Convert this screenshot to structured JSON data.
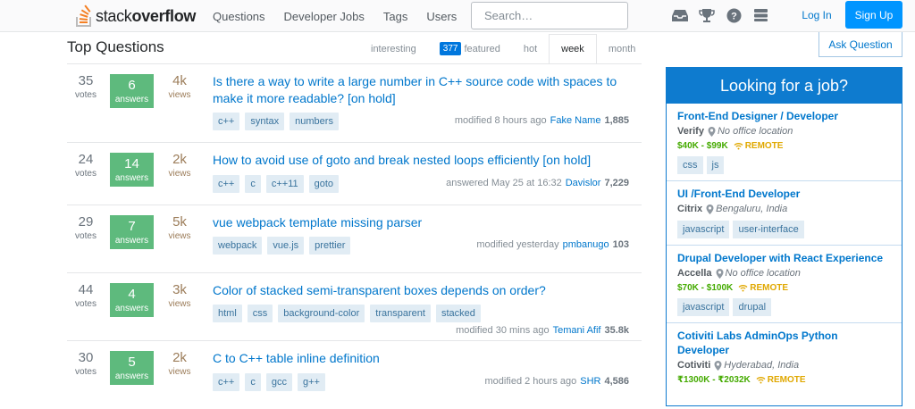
{
  "header": {
    "logo_text_light": "stack",
    "logo_text_bold": "overflow",
    "nav": [
      "Questions",
      "Developer Jobs",
      "Tags",
      "Users"
    ],
    "search_placeholder": "Search…",
    "icons": [
      "inbox-icon",
      "trophy-icon",
      "help-icon",
      "review-queue-icon"
    ],
    "login_label": "Log In",
    "signup_label": "Sign Up"
  },
  "main": {
    "title": "Top Questions",
    "ask_label": "Ask Question",
    "filters": [
      {
        "label": "interesting",
        "badge": ""
      },
      {
        "label": "featured",
        "badge": "377"
      },
      {
        "label": "hot",
        "badge": ""
      },
      {
        "label": "week",
        "badge": "",
        "active": true
      },
      {
        "label": "month",
        "badge": ""
      }
    ],
    "questions": [
      {
        "votes": "35",
        "votes_label": "votes",
        "answers": "6",
        "answers_label": "answers",
        "views": "4k",
        "views_label": "views",
        "title": "Is there a way to write a large number in C++ source code with spaces to make it more readable? [on hold]",
        "tags": [
          "c++",
          "syntax",
          "numbers"
        ],
        "activity": "modified 8 hours ago",
        "user": "Fake Name",
        "rep": "1,885"
      },
      {
        "votes": "24",
        "votes_label": "votes",
        "answers": "14",
        "answers_label": "answers",
        "views": "2k",
        "views_label": "views",
        "title": "How to avoid use of goto and break nested loops efficiently [on hold]",
        "tags": [
          "c++",
          "c",
          "c++11",
          "goto"
        ],
        "activity": "answered May 25 at 16:32",
        "user": "Davislor",
        "rep": "7,229"
      },
      {
        "votes": "29",
        "votes_label": "votes",
        "answers": "7",
        "answers_label": "answers",
        "views": "5k",
        "views_label": "views",
        "title": "vue webpack template missing parser",
        "tags": [
          "webpack",
          "vue.js",
          "prettier"
        ],
        "activity": "modified yesterday",
        "user": "pmbanugo",
        "rep": "103"
      },
      {
        "votes": "44",
        "votes_label": "votes",
        "answers": "4",
        "answers_label": "answers",
        "views": "3k",
        "views_label": "views",
        "title": "Color of stacked semi-transparent boxes depends on order?",
        "tags": [
          "html",
          "css",
          "background-color",
          "transparent",
          "stacked"
        ],
        "activity": "modified 30 mins ago",
        "user": "Temani Afif",
        "rep": "35.8k"
      },
      {
        "votes": "30",
        "votes_label": "votes",
        "answers": "5",
        "answers_label": "answers",
        "views": "2k",
        "views_label": "views",
        "title": "C to C++ table inline definition",
        "tags": [
          "c++",
          "c",
          "gcc",
          "g++"
        ],
        "activity": "modified 2 hours ago",
        "user": "SHR",
        "rep": "4,586"
      }
    ]
  },
  "jobs": {
    "heading": "Looking for a job?",
    "remote_label": "REMOTE",
    "items": [
      {
        "title": "Front-End Designer / Developer",
        "company": "Verify",
        "location": "No office location",
        "salary": "$40K - $99K",
        "remote": true,
        "tags": [
          "css",
          "js"
        ]
      },
      {
        "title": "UI /Front-End Developer",
        "company": "Citrix",
        "location": "Bengaluru, India",
        "salary": "",
        "remote": false,
        "tags": [
          "javascript",
          "user-interface"
        ]
      },
      {
        "title": "Drupal Developer with React Experience",
        "company": "Accella",
        "location": "No office location",
        "salary": "$70K - $100K",
        "remote": true,
        "tags": [
          "javascript",
          "drupal"
        ]
      },
      {
        "title": "Cotiviti Labs AdminOps Python Developer",
        "company": "Cotiviti",
        "location": "Hyderabad, India",
        "salary": "₹1300K - ₹2032K",
        "remote": true,
        "tags": []
      }
    ]
  }
}
